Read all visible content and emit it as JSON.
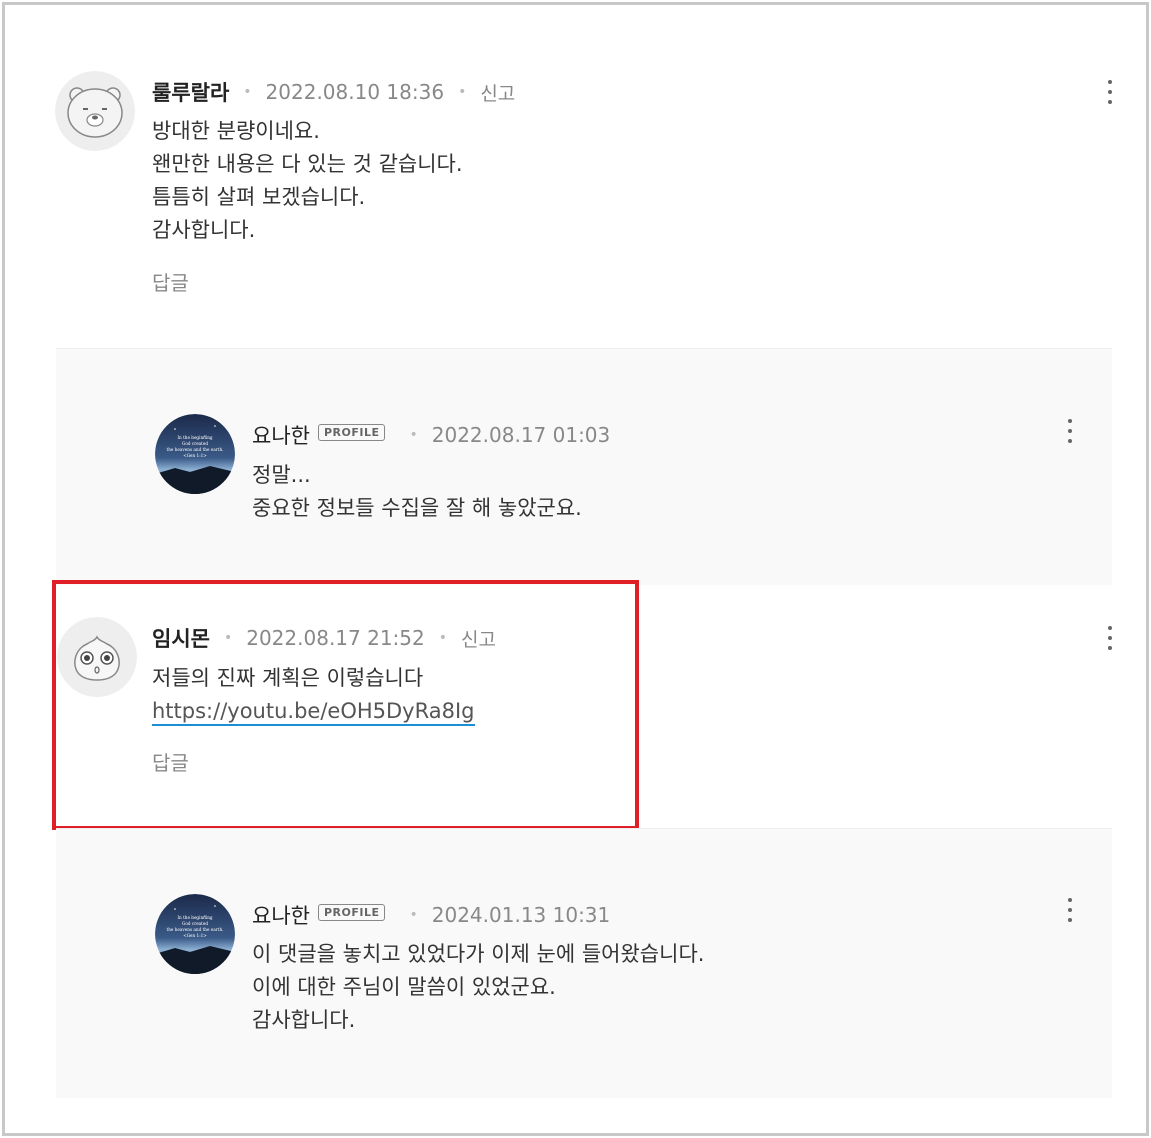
{
  "comments": [
    {
      "author": "룰루랄라",
      "date": "2022.08.10 18:36",
      "report": "신고",
      "lines": [
        "방대한 분량이네요.",
        "왠만한 내용은 다 있는 것 같습니다.",
        "틈틈히 살펴 보겠습니다.",
        "감사합니다."
      ],
      "reply_label": "답글"
    },
    {
      "author": "요나한",
      "badge": "PROFILE",
      "date": "2022.08.17 01:03",
      "lines": [
        "정말...",
        "중요한 정보들 수집을 잘 해 놓았군요."
      ]
    },
    {
      "author": "임시몬",
      "date": "2022.08.17 21:52",
      "report": "신고",
      "lines": [
        "저들의 진짜 계획은 이렇습니다"
      ],
      "link": "https://youtu.be/eOH5DyRa8Ig",
      "reply_label": "답글"
    },
    {
      "author": "요나한",
      "badge": "PROFILE",
      "date": "2024.01.13 10:31",
      "lines": [
        "이 댓글을 놓치고 있었다가 이제 눈에 들어왔습니다.",
        "이에 대한 주님이 말씀이 있었군요.",
        "감사합니다."
      ]
    }
  ],
  "avatar_caption_lines": [
    "In the beginning",
    "God created",
    "the heavens and the earth.",
    "<Gen 1:1>"
  ],
  "colors": {
    "highlight": "#e01e25",
    "link_underline": "#1a8fd6",
    "reply_background": "#f9f9f9"
  }
}
